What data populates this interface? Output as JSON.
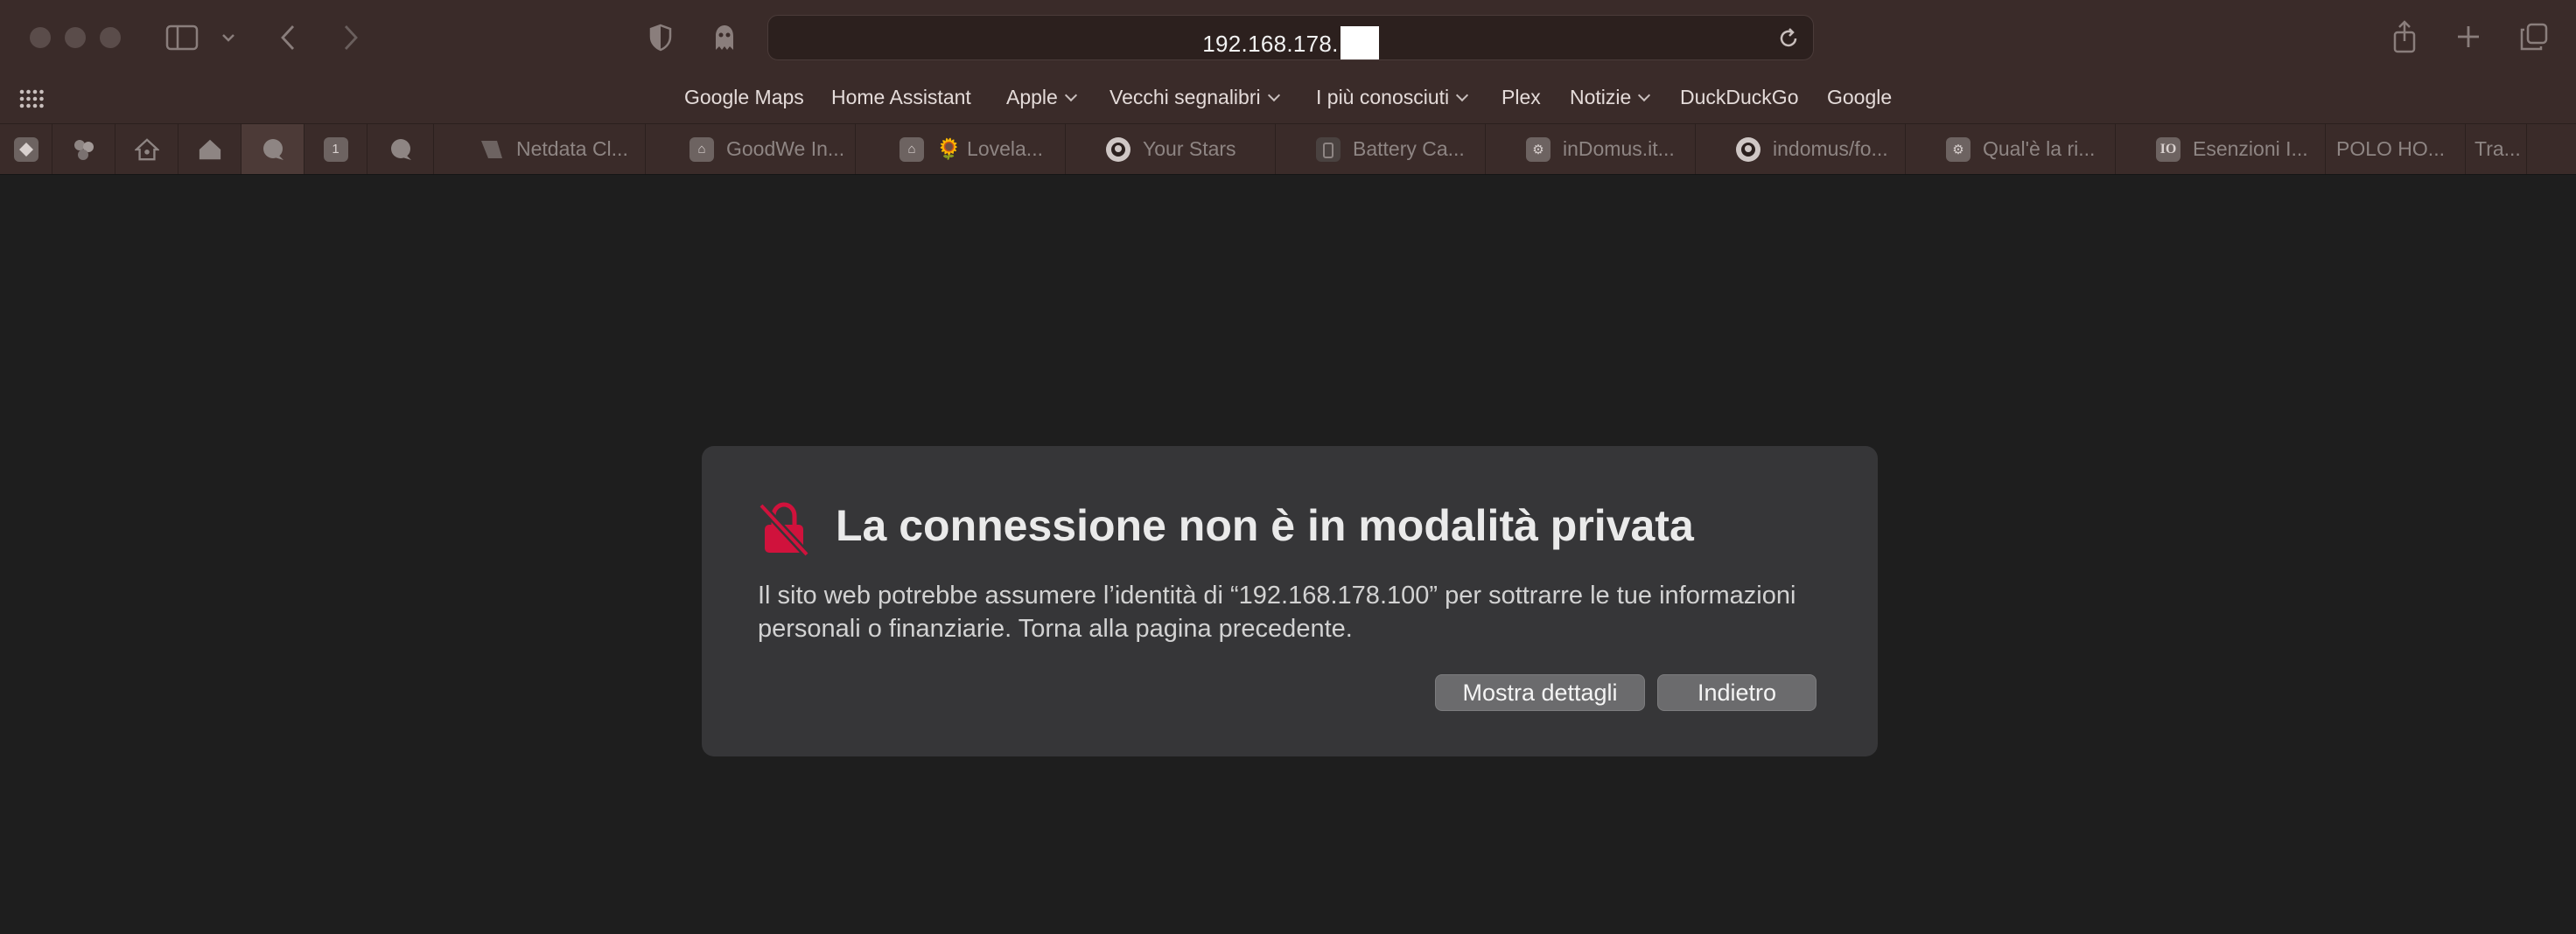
{
  "address_bar": {
    "url": "192.168.178."
  },
  "bookmarks": [
    {
      "label": "Google Maps",
      "has_menu": false
    },
    {
      "label": "Home Assistant",
      "has_menu": false
    },
    {
      "label": "Apple",
      "has_menu": true
    },
    {
      "label": "Vecchi segnalibri",
      "has_menu": true
    },
    {
      "label": "I più conosciuti",
      "has_menu": true
    },
    {
      "label": "Plex",
      "has_menu": false
    },
    {
      "label": "Notizie",
      "has_menu": true
    },
    {
      "label": "DuckDuckGo",
      "has_menu": false
    },
    {
      "label": "Google",
      "has_menu": false
    }
  ],
  "pinned_tabs": [
    {
      "icon": "plex-icon"
    },
    {
      "icon": "cluster-icon"
    },
    {
      "icon": "home-assistant-icon"
    },
    {
      "icon": "home-icon"
    },
    {
      "icon": "chat-bubble-icon",
      "active": true
    },
    {
      "icon": "number-badge-icon",
      "label": "1"
    },
    {
      "icon": "chat-bubble-icon"
    }
  ],
  "tabs": [
    {
      "label": "Netdata Cl...",
      "icon": "netdata-icon"
    },
    {
      "label": "GoodWe In...",
      "icon": "home-icon"
    },
    {
      "label": "🌻 Lovela...",
      "icon": "home-icon"
    },
    {
      "label": "Your Stars",
      "icon": "github-icon"
    },
    {
      "label": "Battery Ca...",
      "icon": "battery-icon"
    },
    {
      "label": "inDomus.it...",
      "icon": "gear-icon"
    },
    {
      "label": "indomus/fo...",
      "icon": "github-icon"
    },
    {
      "label": "Qual'è la ri...",
      "icon": "gear-icon"
    },
    {
      "label": "Esenzioni I...",
      "icon": "io-icon",
      "icon_text": "IO"
    },
    {
      "label": "POLO HO...",
      "icon": ""
    },
    {
      "label": "Tra...",
      "icon": ""
    }
  ],
  "dialog": {
    "title": "La connessione non è in modalità privata",
    "body": "Il sito web potrebbe assumere l’identità di “192.168.178.100” per sottrarre le tue informazioni personali o finanziarie. Torna alla pagina precedente.",
    "details_button": "Mostra dettagli",
    "back_button": "Indietro",
    "icon": "broken-lock-icon"
  },
  "colors": {
    "chrome": "#3a2b29",
    "page": "#1e1e1e",
    "dialog": "#363638",
    "warning": "#d0123c"
  }
}
